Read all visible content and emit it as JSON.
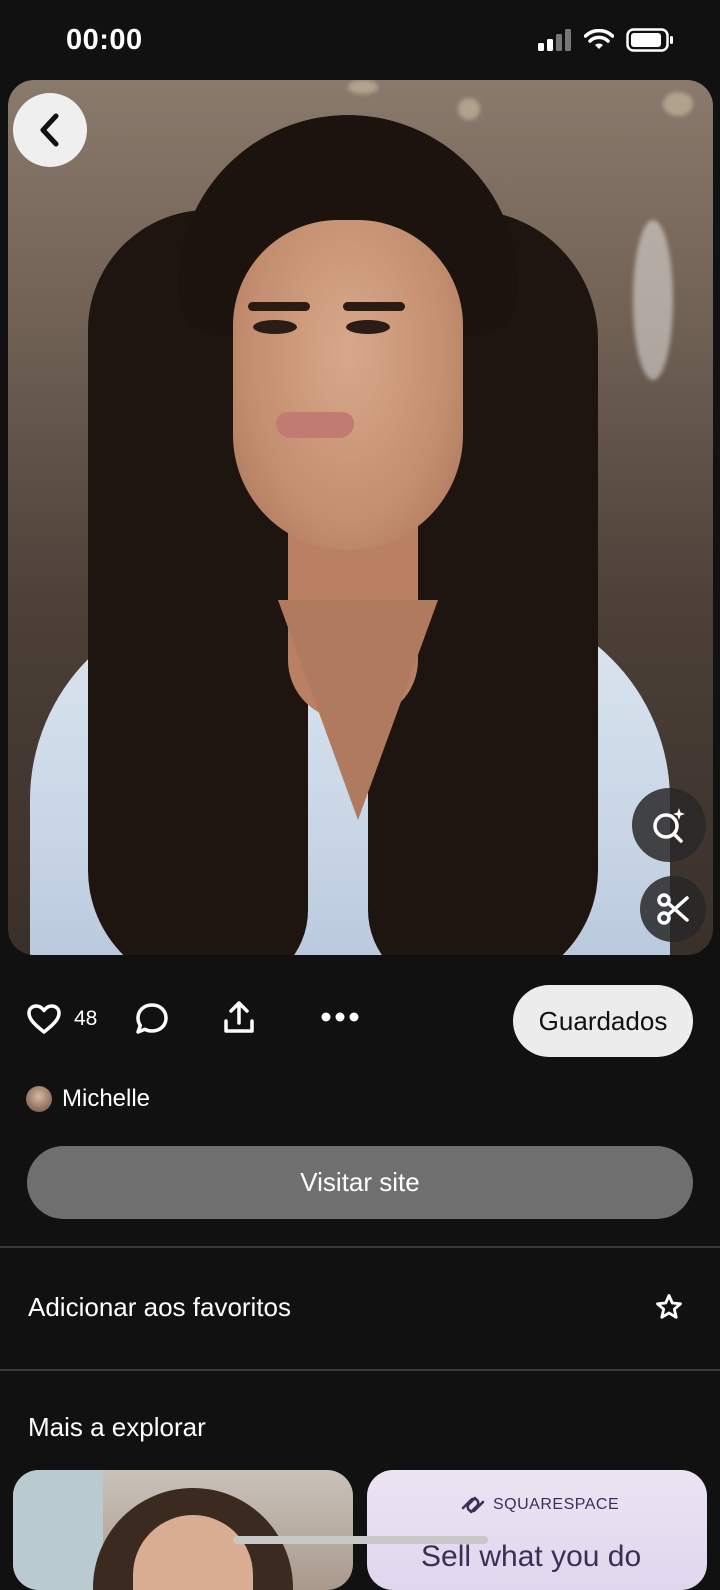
{
  "status_bar": {
    "time": "00:00",
    "battery_icon": "battery-icon",
    "wifi_icon": "wifi-icon",
    "signal_icon": "signal-icon"
  },
  "pin": {
    "likes_count": "48",
    "save_label": "Guardados",
    "author_name": "Michelle",
    "visit_label": "Visitar site"
  },
  "favorites": {
    "label": "Adicionar aos favoritos"
  },
  "explore": {
    "title": "Mais a explorar",
    "cards": [
      {
        "type": "image"
      },
      {
        "brand": "SQUARESPACE",
        "headline": "Sell what you do"
      }
    ]
  },
  "colors": {
    "background": "#111111",
    "accent_button": "#ececec",
    "visit_button": "#6f6f6f"
  }
}
